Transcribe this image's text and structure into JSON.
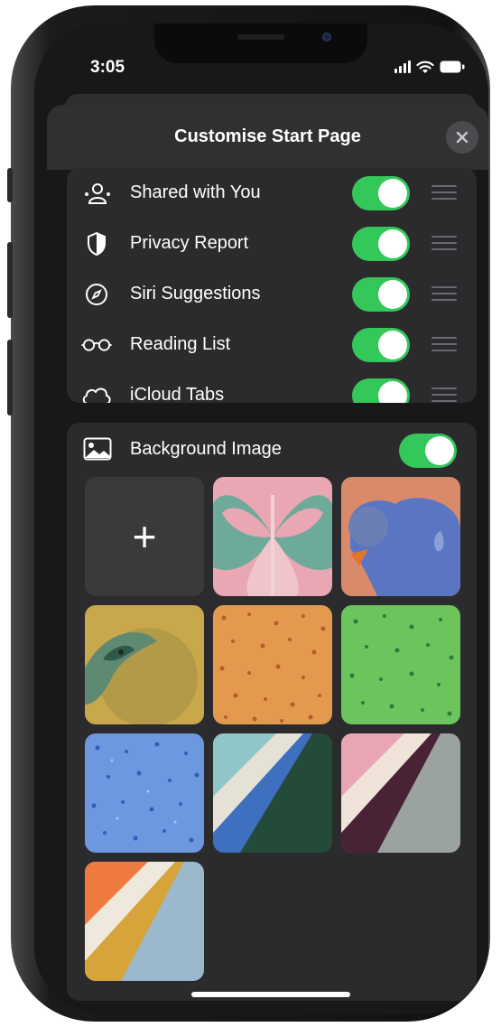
{
  "status_bar": {
    "time": "3:05"
  },
  "sheet": {
    "title": "Customise Start Page",
    "close_icon": "close-icon"
  },
  "sections": [
    {
      "label": "Shared with You",
      "icon": "shared-with-you-icon",
      "enabled": true
    },
    {
      "label": "Privacy Report",
      "icon": "shield-icon",
      "enabled": true
    },
    {
      "label": "Siri Suggestions",
      "icon": "compass-icon",
      "enabled": true
    },
    {
      "label": "Reading List",
      "icon": "glasses-icon",
      "enabled": true
    },
    {
      "label": "iCloud Tabs",
      "icon": "cloud-icon",
      "enabled": true
    }
  ],
  "background": {
    "label": "Background Image",
    "enabled": true,
    "add_label": "+",
    "images": [
      "butterfly",
      "bear",
      "parrot",
      "orange-dots",
      "green-dots",
      "blue-dots",
      "blue-green-stripes",
      "pink-plum-stripes",
      "orange-yellow-stripes"
    ]
  },
  "colors": {
    "toggle_on": "#34c759",
    "background": "#18181a",
    "card": "#2b2b2d"
  }
}
